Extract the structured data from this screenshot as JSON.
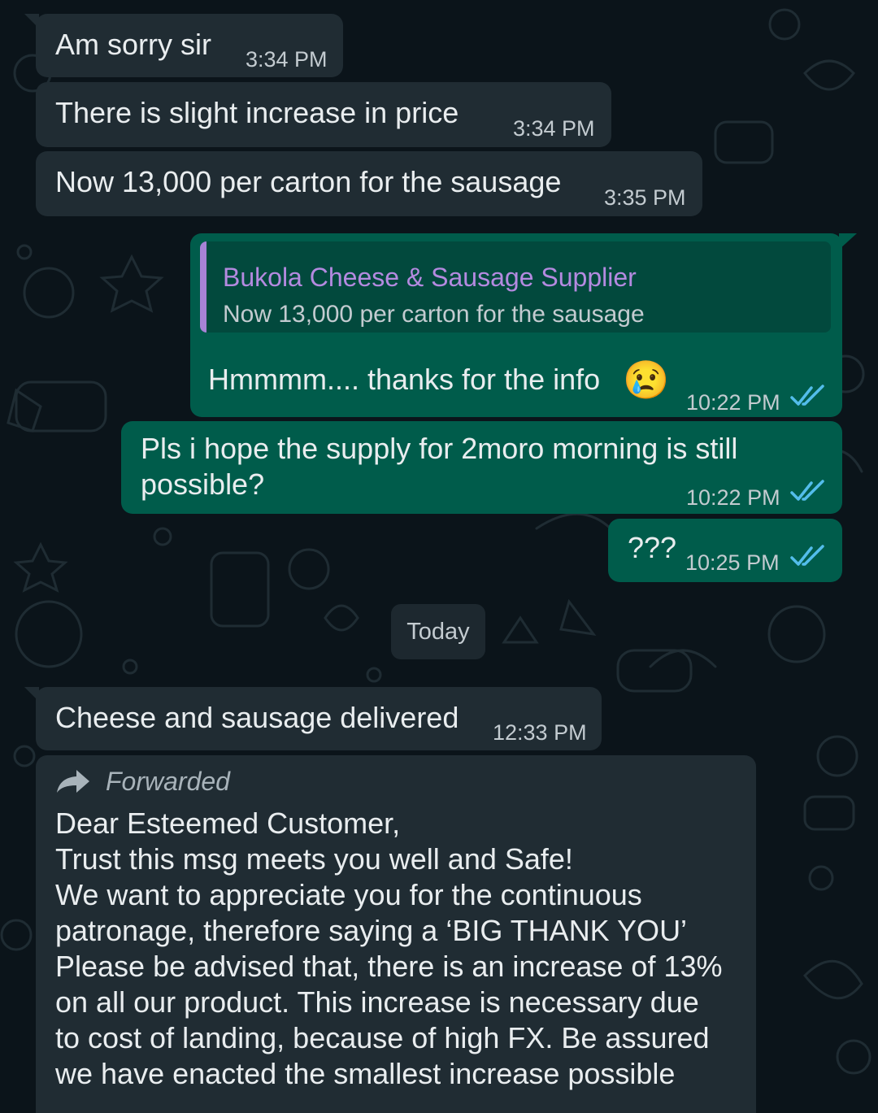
{
  "conversation": {
    "messages": [
      {
        "text": "Am sorry sir",
        "time": "3:34 PM"
      },
      {
        "text": "There  is slight increase  in price",
        "time": "3:34 PM"
      },
      {
        "text": "Now 13,000 per carton for the sausage",
        "time": "3:35 PM"
      },
      {
        "quote_sender": "Bukola Cheese & Sausage Supplier",
        "quote_text": "Now 13,000 per carton for the sausage",
        "text": "Hmmmm.... thanks for the info",
        "emoji": "😢",
        "time": "10:22 PM"
      },
      {
        "text_line1": "Pls i hope the supply for 2moro morning is still",
        "text_line2": "possible?",
        "time": "10:22 PM"
      },
      {
        "text": "???",
        "time": "10:25 PM"
      }
    ],
    "date_separator": "Today",
    "today_messages": [
      {
        "text": "Cheese and sausage delivered",
        "time": "12:33 PM"
      },
      {
        "forwarded_label": "Forwarded",
        "lines": [
          "Dear Esteemed Customer,",
          "Trust this msg meets you well and Safe!",
          "We want to appreciate you for the continuous",
          "patronage, therefore saying a ‘BIG THANK YOU’",
          "Please be advised that, there is an increase of 13%",
          "on all our product. This increase is necessary due",
          "to cost of landing, because of high FX. Be assured",
          "we have enacted the smallest increase possible"
        ]
      }
    ]
  },
  "colors": {
    "background": "#0b141a",
    "incoming_bubble": "#202c33",
    "outgoing_bubble": "#005c4b",
    "read_ticks": "#53bdeb",
    "quote_accent": "#a783d6"
  },
  "icons": {
    "read_receipt": "double-check-icon",
    "forwarded": "forward-arrow-icon"
  }
}
